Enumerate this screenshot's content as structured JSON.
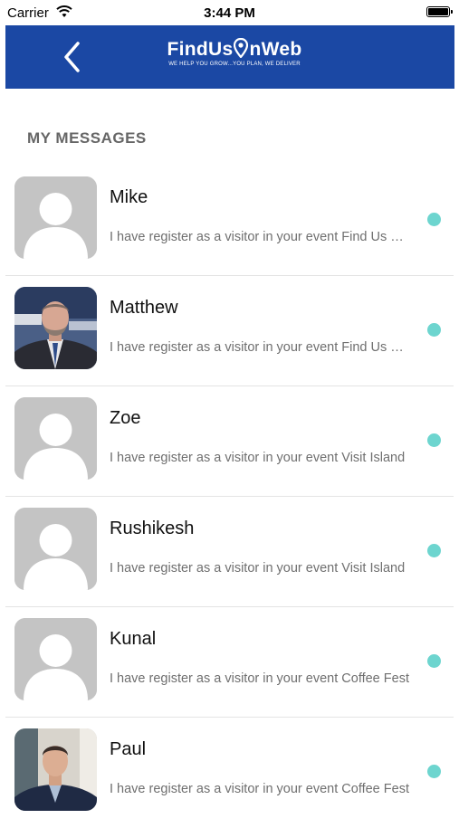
{
  "status_bar": {
    "carrier": "Carrier",
    "time": "3:44 PM"
  },
  "header": {
    "logo_name_part1": "FindUs",
    "logo_name_part2": "nWeb",
    "logo_tagline": "WE HELP YOU GROW...YOU PLAN, WE DELIVER",
    "brand_color": "#1b48a4"
  },
  "section": {
    "title": "MY MESSAGES"
  },
  "unread_color": "#6dd5cf",
  "messages": [
    {
      "name": "Mike",
      "preview": "I have register as a visitor in your event Find Us On Web",
      "avatar": "placeholder-avatar",
      "unread": true
    },
    {
      "name": "Matthew",
      "preview": "I have register as a visitor in your event Find Us On Web",
      "avatar": "photo-avatar",
      "unread": true
    },
    {
      "name": "Zoe",
      "preview": "I have register as a visitor in your event Visit Island",
      "avatar": "placeholder-avatar",
      "unread": true
    },
    {
      "name": "Rushikesh",
      "preview": "I have register as a visitor in your event Visit Island",
      "avatar": "placeholder-avatar",
      "unread": true
    },
    {
      "name": "Kunal",
      "preview": "I have register as a visitor in your event Coffee Fest",
      "avatar": "placeholder-avatar",
      "unread": true
    },
    {
      "name": "Paul",
      "preview": "I have register as a visitor in your event Coffee Fest",
      "avatar": "photo-avatar",
      "unread": true
    }
  ]
}
